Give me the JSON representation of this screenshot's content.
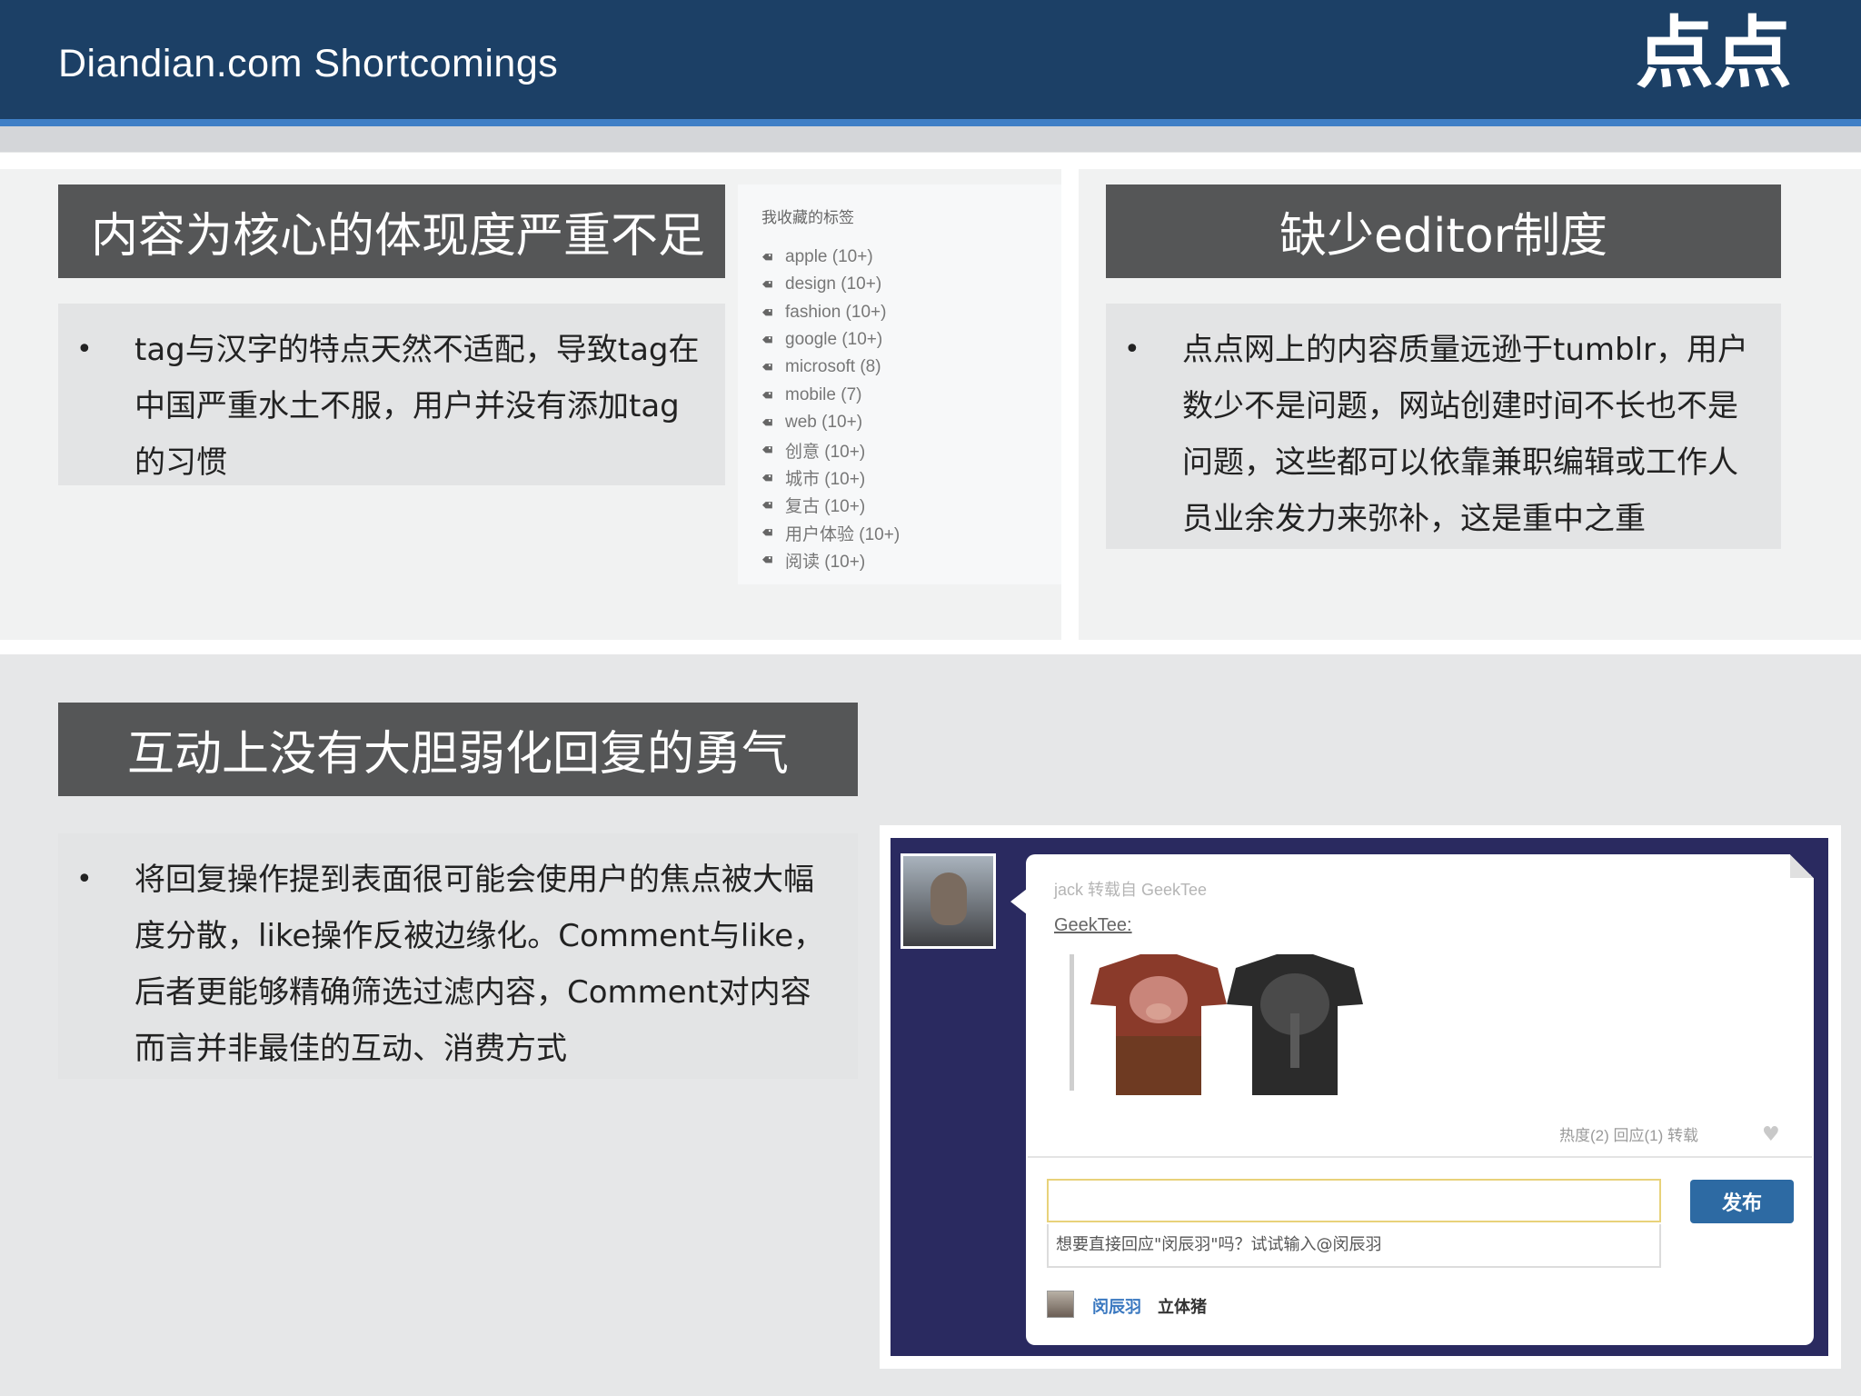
{
  "header": {
    "title": "Diandian.com Shortcomings",
    "logo_text": "点点"
  },
  "section1": {
    "title": "内容为核心的体现度严重不足",
    "bullet_lines": [
      "tag与汉字的特点天然不适配，导致tag在",
      "中国严重水土不服，用户并没有添加tag",
      "的习惯"
    ]
  },
  "tag_list": {
    "header": "我收藏的标签",
    "items": [
      "apple (10+)",
      "design (10+)",
      "fashion (10+)",
      "google (10+)",
      "microsoft (8)",
      "mobile (7)",
      "web (10+)",
      "创意 (10+)",
      "城市 (10+)",
      "复古 (10+)",
      "用户体验 (10+)",
      "阅读 (10+)"
    ]
  },
  "section2": {
    "title": "缺少editor制度",
    "bullet_lines": [
      "点点网上的内容质量远逊于tumblr，用户",
      "数少不是问题，网站创建时间不长也不是",
      "问题，这些都可以依靠兼职编辑或工作人",
      "员业余发力来弥补，这是重中之重"
    ]
  },
  "section3": {
    "title": "互动上没有大胆弱化回复的勇气",
    "bullet_lines": [
      "将回复操作提到表面很可能会使用户的焦点被大幅",
      "度分散，like操作反被边缘化。Comment与like，",
      "后者更能够精确筛选过滤内容，Comment对内容",
      "而言并非最佳的互动、消费方式"
    ]
  },
  "screenshot": {
    "meta": "jack 转载自 GeekTee",
    "source_link": "GeekTee:",
    "stats": "热度(2)  回应(1)  转载",
    "reply_placeholder": "",
    "hint": "想要直接回应\"闵辰羽\"吗？试试输入@闵辰羽",
    "publish_label": "发布",
    "user_name": "闵辰羽",
    "user_sub": "立体猪"
  },
  "colors": {
    "header_bg": "#1c4066",
    "header_stripe": "#3f7fc6",
    "title_bar": "#555657",
    "publish_btn": "#2d6aa3",
    "screenshot_bg": "#2a2a60"
  }
}
